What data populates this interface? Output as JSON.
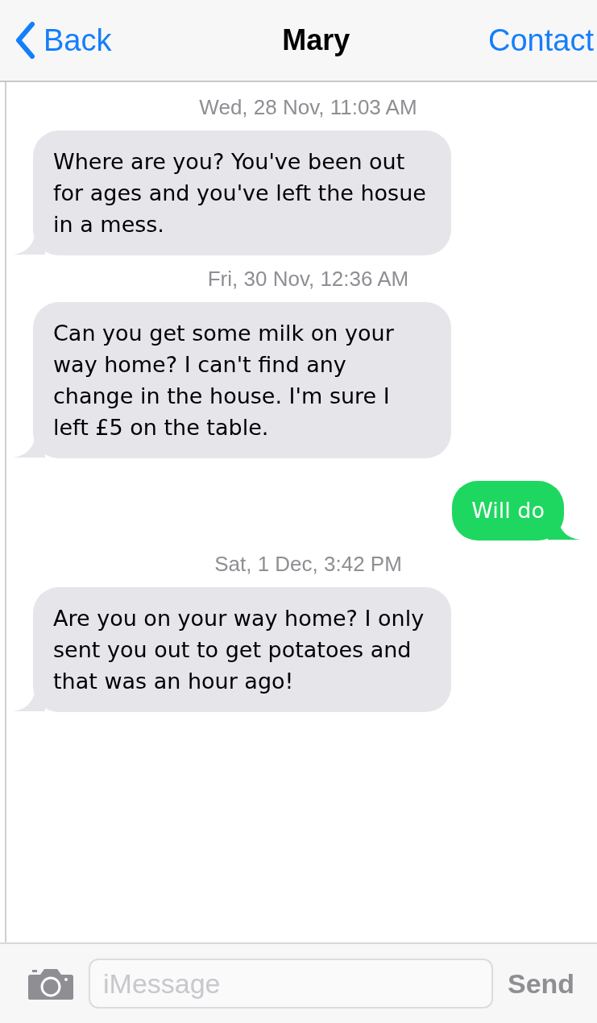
{
  "nav_bar": {
    "back": "Back",
    "title": "Mary",
    "action": "Contact"
  },
  "messages": [
    {
      "kind": "timestamp",
      "text": "Wed, 28 Nov, 11:03 AM"
    },
    {
      "kind": "incoming",
      "text": "Where are you? You've been out for ages and you've left the hosue in a mess."
    },
    {
      "kind": "timestamp",
      "text": "Fri, 30 Nov, 12:36 AM"
    },
    {
      "kind": "incoming",
      "text": "Can you get some milk on your way home? I can't find any change in the house. I'm sure I left £5 on the table."
    },
    {
      "kind": "outgoing",
      "text": "Will do"
    },
    {
      "kind": "timestamp",
      "text": "Sat, 1 Dec, 3:42 PM"
    },
    {
      "kind": "incoming",
      "text": "Are you on your way home? I only sent you out to get potatoes and that was an hour ago!"
    }
  ],
  "composer": {
    "placeholder": "iMessage",
    "send": "Send"
  }
}
